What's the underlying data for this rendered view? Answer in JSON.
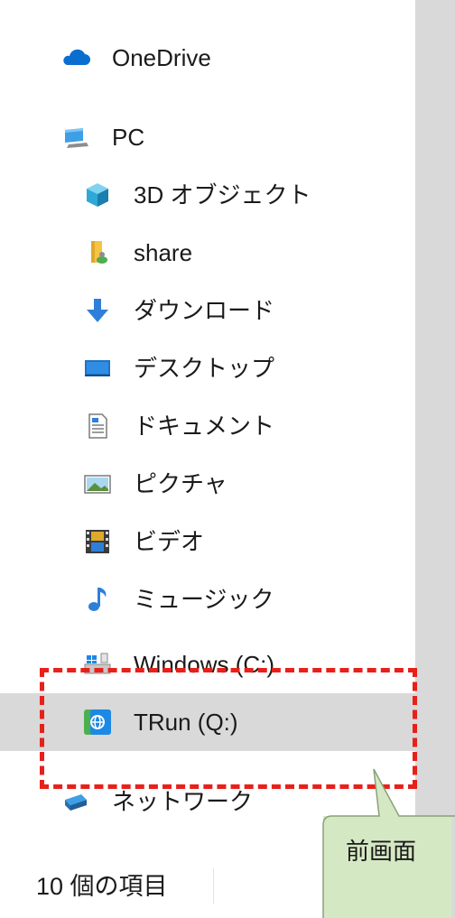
{
  "nav": {
    "onedrive": {
      "label": "OneDrive",
      "icon": "cloud-icon"
    },
    "pc": {
      "label": "PC",
      "icon": "computer-icon"
    },
    "objects3d": {
      "label": "3D オブジェクト",
      "icon": "cube-icon"
    },
    "share": {
      "label": "share",
      "icon": "user-folder-icon"
    },
    "downloads": {
      "label": "ダウンロード",
      "icon": "download-arrow-icon"
    },
    "desktop": {
      "label": "デスクトップ",
      "icon": "desktop-icon"
    },
    "documents": {
      "label": "ドキュメント",
      "icon": "document-icon"
    },
    "pictures": {
      "label": "ピクチャ",
      "icon": "picture-icon"
    },
    "videos": {
      "label": "ビデオ",
      "icon": "film-icon"
    },
    "music": {
      "label": "ミュージック",
      "icon": "music-note-icon"
    },
    "windows_c": {
      "label": "Windows (C:)",
      "icon": "windows-drive-icon"
    },
    "trun_q": {
      "label": "TRun (Q:)",
      "icon": "trun-drive-icon",
      "selected": true
    },
    "network": {
      "label": "ネットワーク",
      "icon": "network-icon"
    }
  },
  "status": {
    "item_count": "10 個の項目"
  },
  "callout": {
    "text": "前画面"
  },
  "colors": {
    "highlight": "#e8201a",
    "callout_fill": "#d5e8c4",
    "callout_border": "#8aa07a",
    "selection": "#d9d9d9"
  }
}
